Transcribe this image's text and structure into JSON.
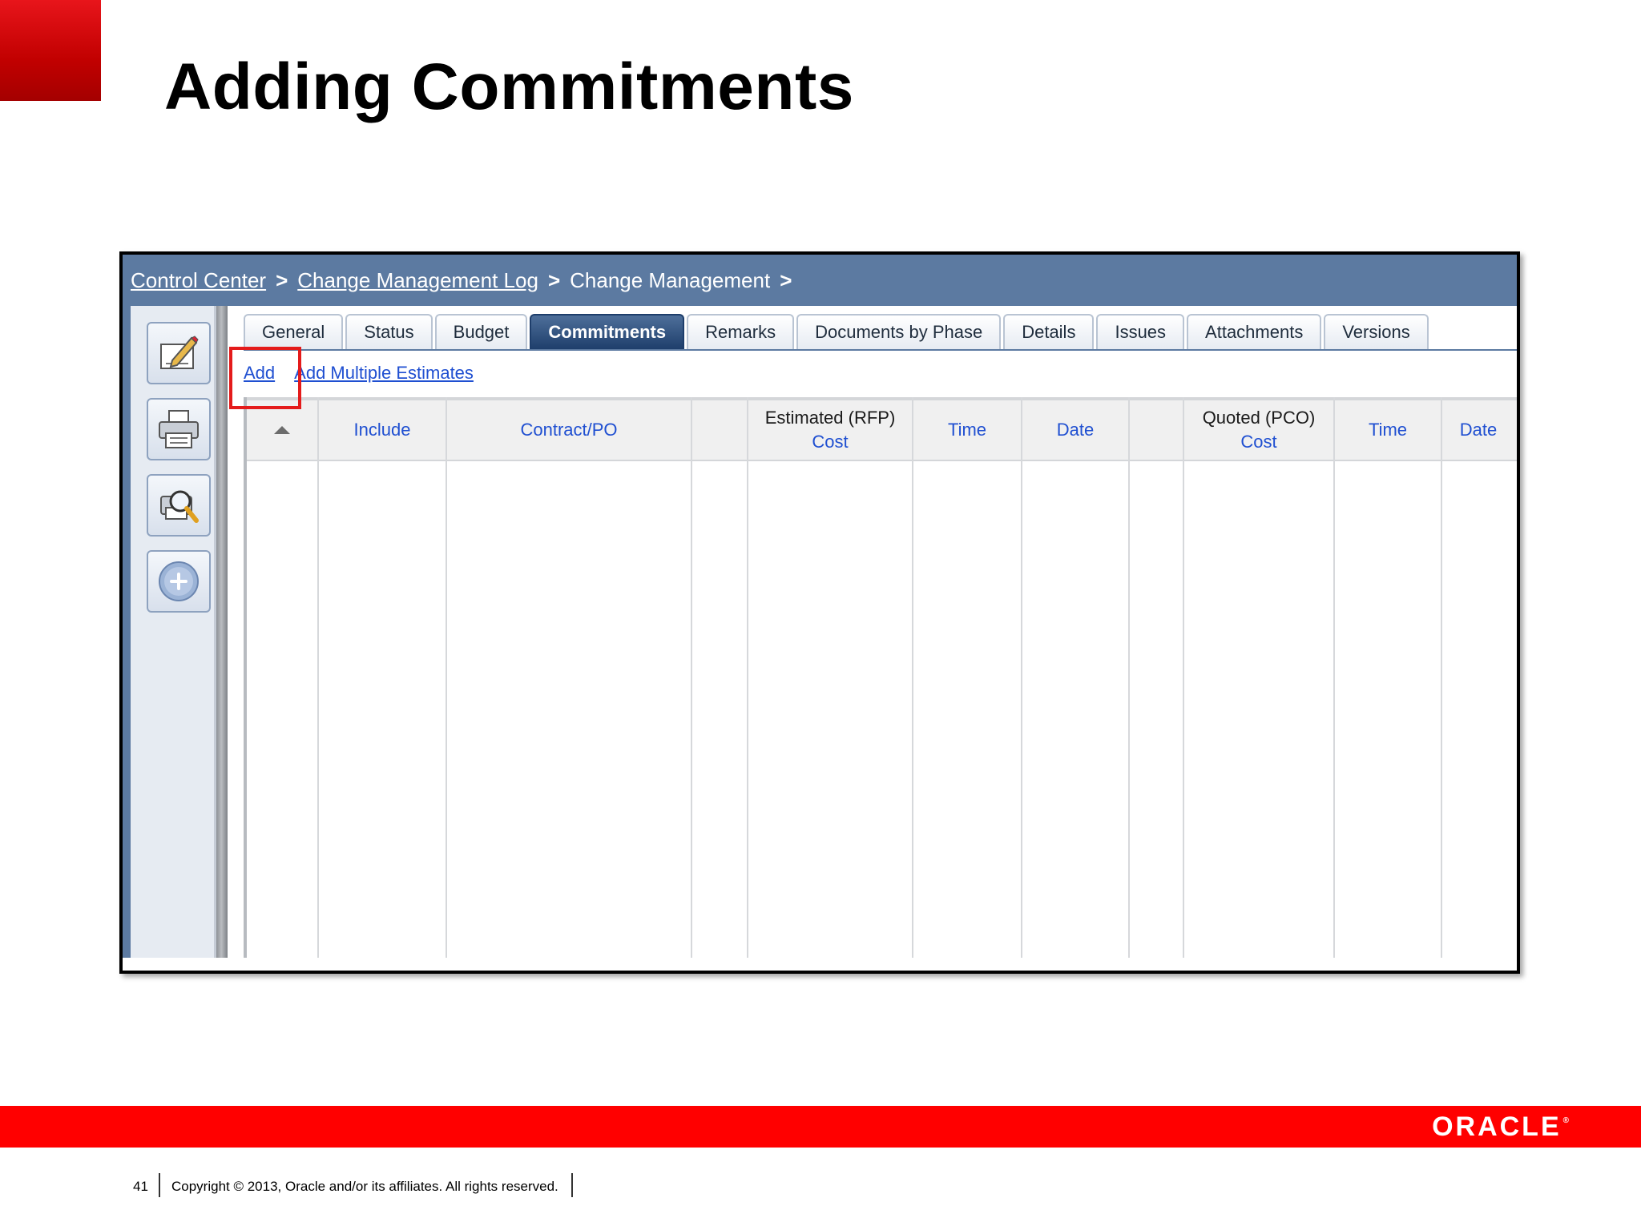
{
  "slide": {
    "title": "Adding Commitments",
    "page_number": "41",
    "copyright": "Copyright © 2013, Oracle and/or its affiliates. All rights reserved.",
    "logo": "ORACLE",
    "logo_tm": "®",
    "brand_red": "#ff0000"
  },
  "breadcrumb": {
    "items": [
      {
        "label": "Control Center",
        "link": true
      },
      {
        "label": "Change Management Log",
        "link": true
      },
      {
        "label": "Change Management",
        "link": false
      }
    ],
    "separator": ">"
  },
  "toolbar": {
    "buttons": [
      {
        "icon": "edit-icon"
      },
      {
        "icon": "print-icon"
      },
      {
        "icon": "print-preview-icon"
      },
      {
        "icon": "add-icon"
      }
    ]
  },
  "tabs": {
    "items": [
      {
        "label": "General"
      },
      {
        "label": "Status"
      },
      {
        "label": "Budget"
      },
      {
        "label": "Commitments",
        "active": true
      },
      {
        "label": "Remarks"
      },
      {
        "label": "Documents by Phase"
      },
      {
        "label": "Details"
      },
      {
        "label": "Issues"
      },
      {
        "label": "Attachments"
      },
      {
        "label": "Versions"
      }
    ]
  },
  "actions": {
    "add": "Add",
    "add_multiple": "Add Multiple Estimates"
  },
  "grid": {
    "columns": {
      "include": "Include",
      "contract_po": "Contract/PO",
      "estimated_group": "Estimated (RFP)",
      "estimated_cost": "Cost",
      "estimated_time": "Time",
      "estimated_date": "Date",
      "quoted_group": "Quoted (PCO)",
      "quoted_cost": "Cost",
      "quoted_time": "Time",
      "quoted_date": "Date"
    },
    "rows": []
  }
}
